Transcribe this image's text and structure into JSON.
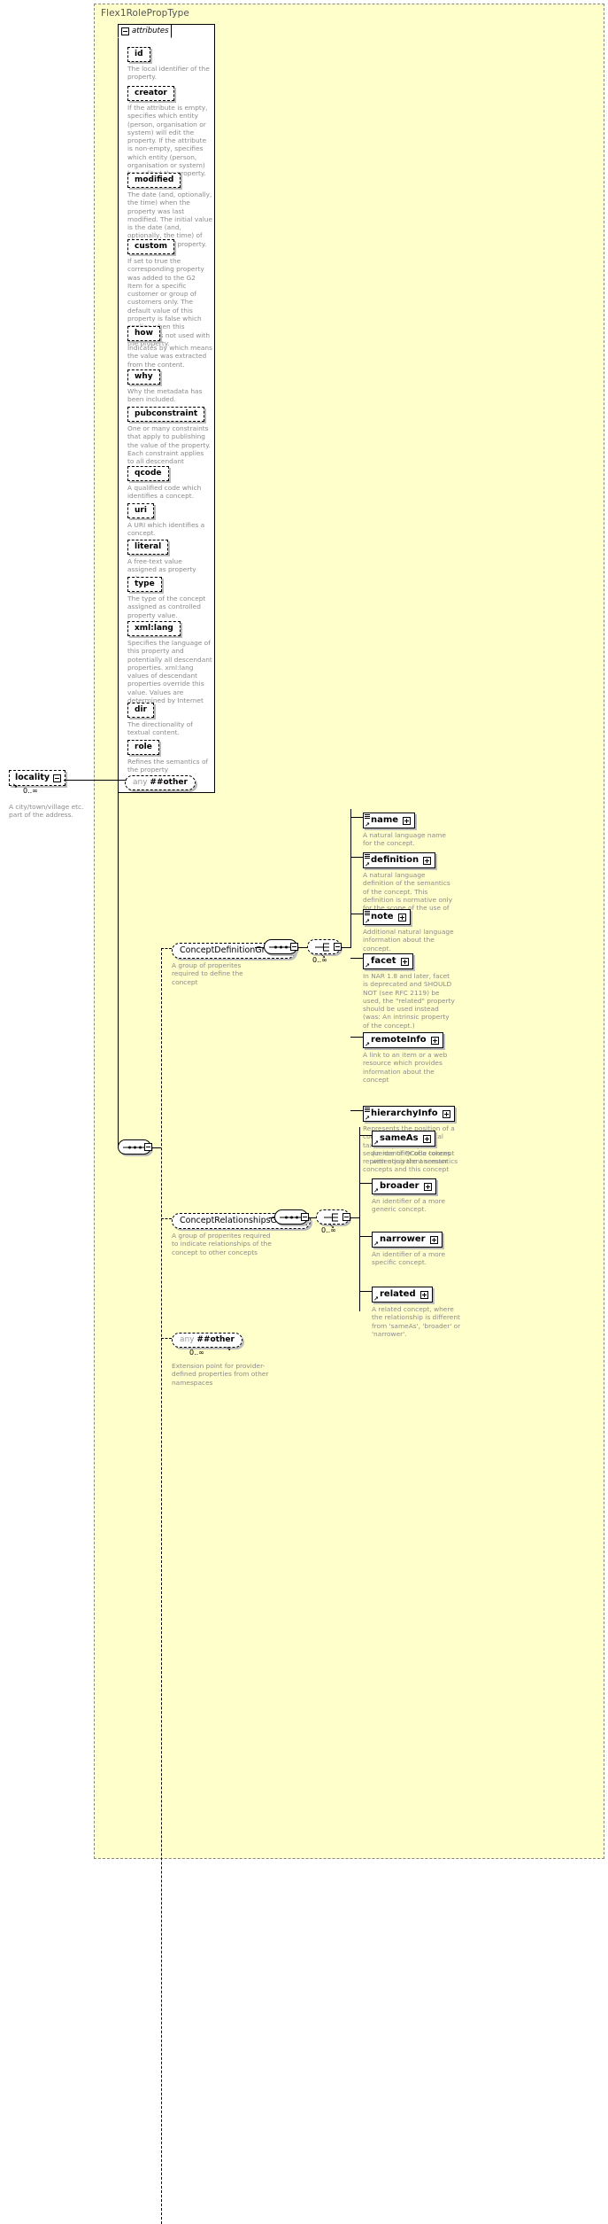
{
  "diagram": {
    "type_title": "Flex1RolePropType",
    "attributes_panel": {
      "tab_label": "attributes",
      "items": [
        {
          "name": "id",
          "doc": "The local identifier of the property."
        },
        {
          "name": "creator",
          "doc": "If the attribute is empty, specifies which entity (person, organisation or system) will edit the property. If the attribute is non-empty, specifies which entity (person, organisation or system) has edited the property."
        },
        {
          "name": "modified",
          "doc": "The date (and, optionally, the time) when the property was last modified. The initial value is the date (and, optionally, the time) of creation of the property."
        },
        {
          "name": "custom",
          "doc": "If set to true the corresponding property was added to the G2 Item for a specific customer or group of customers only. The default value of this property is false which applies when this attribute is not used with the property."
        },
        {
          "name": "how",
          "doc": "Indicates by which means the value was extracted from the content."
        },
        {
          "name": "why",
          "doc": "Why the metadata has been included."
        },
        {
          "name": "pubconstraint",
          "doc": "One or many constraints that apply to publishing the value of the property. Each constraint applies to all descendant elements."
        },
        {
          "name": "qcode",
          "doc": "A qualified code which identifies a concept."
        },
        {
          "name": "uri",
          "doc": "A URI which identifies a concept."
        },
        {
          "name": "literal",
          "doc": "A free-text value assigned as property value."
        },
        {
          "name": "type",
          "doc": "The type of the concept assigned as controlled property value."
        },
        {
          "name": "xml:lang",
          "doc": "Specifies the language of this property and potentially all descendant properties. xml:lang values of descendant properties override this value. Values are determined by Internet BCP 47."
        },
        {
          "name": "dir",
          "doc": "The directionality of textual content."
        },
        {
          "name": "role",
          "doc": "Refines the semantics of the property"
        }
      ],
      "any": {
        "word": "any",
        "namespace": "##other"
      }
    },
    "root_element": {
      "name": "locality",
      "cardinality": "0..∞",
      "doc": "A city/town/village etc. part of the address."
    },
    "groups": [
      {
        "name": "ConceptDefinitionGroup",
        "doc": "A group of properites required to define the concept",
        "cardinality": "0..∞",
        "children": [
          {
            "name": "name",
            "doc": "A natural language name for the concept.",
            "has_attrs": true
          },
          {
            "name": "definition",
            "doc": "A natural language definition of the semantics of the concept. This definition is normative only for the scope of the use of this concept.",
            "has_attrs": true
          },
          {
            "name": "note",
            "doc": "Additional natural language information about the concept.",
            "has_attrs": true
          },
          {
            "name": "facet",
            "doc": "In NAR 1.8 and later, facet is deprecated and SHOULD NOT (see RFC 2119) be used, the \"related\" property should be used instead (was: An intrinsic property of the concept.)",
            "has_attrs": false
          },
          {
            "name": "remoteInfo",
            "doc": "A link to an item or a web resource which provides information about the concept",
            "has_attrs": false
          },
          {
            "name": "hierarchyInfo",
            "doc": "Represents the position of a concept in a hierarchical taxonomy tree by a sequence of QCode tokens representing the ancestor concepts and this concept",
            "has_attrs": true
          }
        ]
      },
      {
        "name": "ConceptRelationshipsGroup",
        "doc": "A group of properites required to indicate relationships of the concept to other concepts",
        "cardinality": "0..∞",
        "children": [
          {
            "name": "sameAs",
            "doc": "An identifier of a concept with equivalent semantics",
            "has_attrs": false
          },
          {
            "name": "broader",
            "doc": "An identifier of a more generic concept.",
            "has_attrs": false
          },
          {
            "name": "narrower",
            "doc": "An identifier of a more specific concept.",
            "has_attrs": false
          },
          {
            "name": "related",
            "doc": "A related concept, where the relationship is different from 'sameAs', 'broader' or 'narrower'.",
            "has_attrs": false
          }
        ]
      }
    ],
    "extension_any": {
      "word": "any",
      "namespace": "##other",
      "cardinality": "0..∞",
      "doc": "Extension point for provider-defined properties from other namespaces"
    },
    "colors": {
      "type_background": "#ffffcc",
      "panel_background": "#ffffff",
      "doc_text": "#8b8b8b",
      "border": "#000000"
    }
  }
}
